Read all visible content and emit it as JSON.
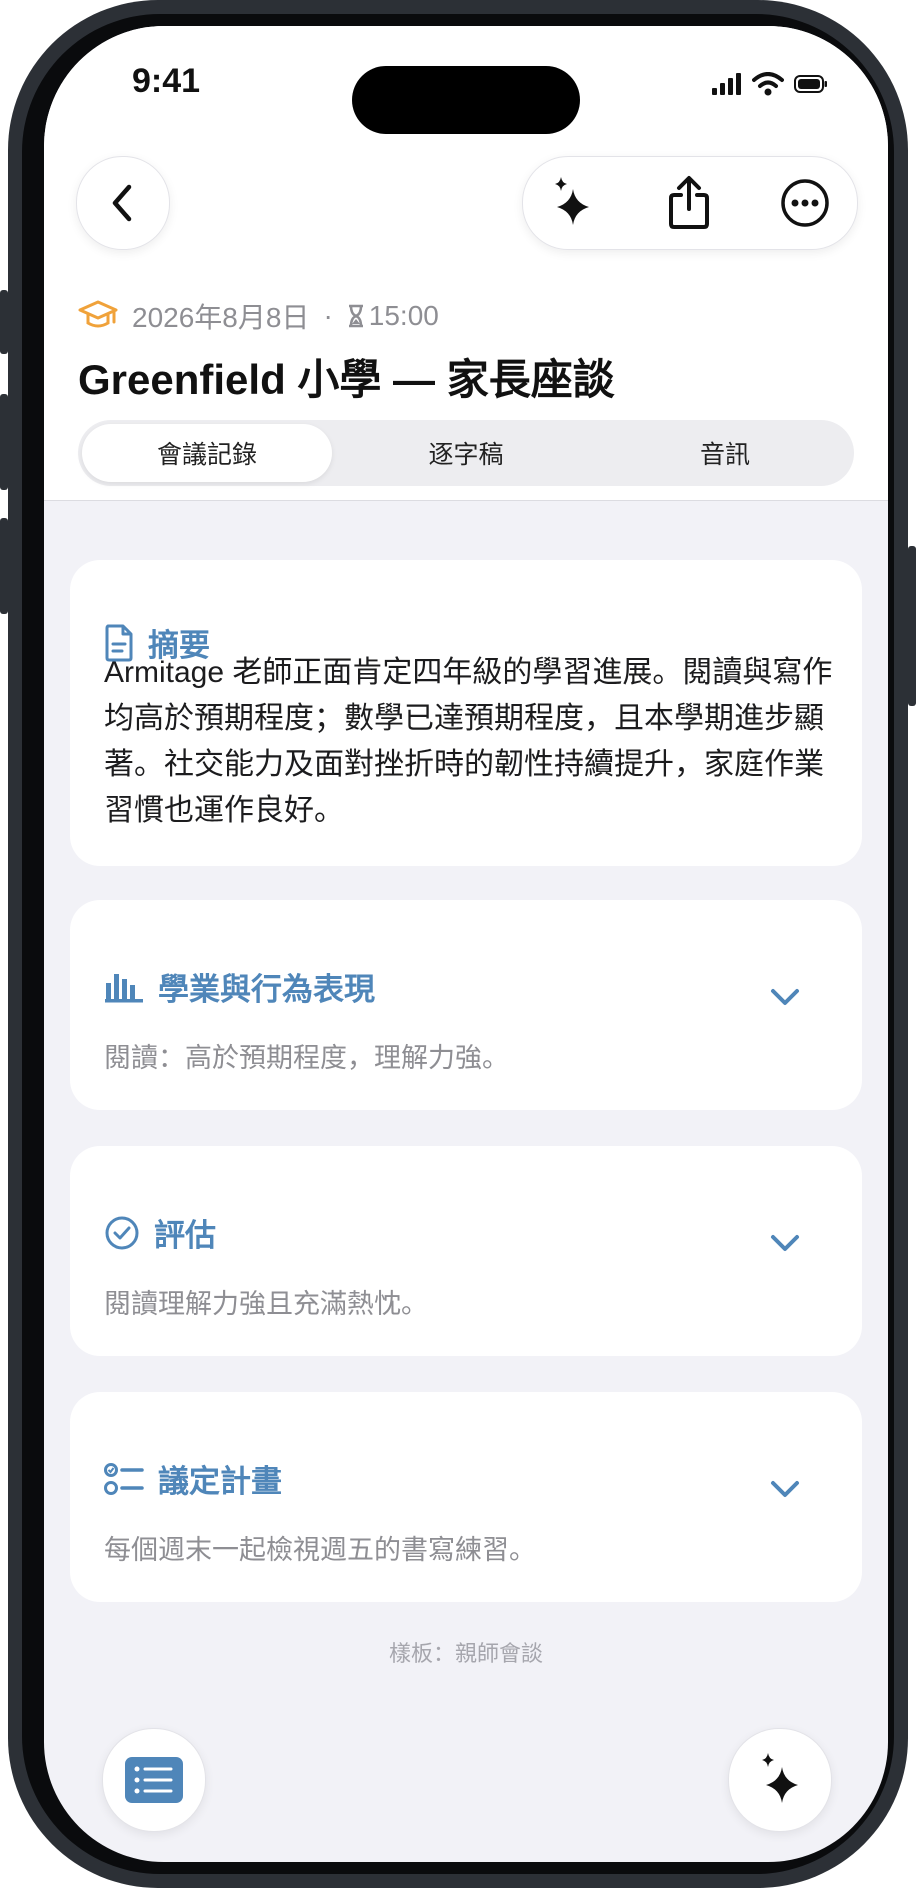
{
  "status": {
    "time": "9:41"
  },
  "header": {
    "date": "2026年8月8日",
    "separator": "·",
    "time": "15:00",
    "title": "Greenfield 小學 — 家長座談"
  },
  "tabs": [
    {
      "label": "會議記錄",
      "active": true
    },
    {
      "label": "逐字稿",
      "active": false
    },
    {
      "label": "音訊",
      "active": false
    }
  ],
  "summary": {
    "title": "摘要",
    "text": "Armitage 老師正面肯定四年級的學習進展。閱讀與寫作均高於預期程度；數學已達預期程度，且本學期進步顯著。社交能力及面對挫折時的韌性持續提升，家庭作業習慣也運作良好。"
  },
  "sections": [
    {
      "title": "學業與行為表現",
      "preview": "閱讀：高於預期程度，理解力強。",
      "icon": "bar-chart-icon"
    },
    {
      "title": "評估",
      "preview": "閱讀理解力強且充滿熱忱。",
      "icon": "checkmark-circle-icon"
    },
    {
      "title": "議定計畫",
      "preview": "每個週末一起檢視週五的書寫練習。",
      "icon": "checklist-icon"
    }
  ],
  "footer": {
    "template_note": "樣板：親師會談"
  },
  "colors": {
    "accent": "#4f86b9",
    "orange": "#f0a23a",
    "background": "#f2f2f7"
  }
}
